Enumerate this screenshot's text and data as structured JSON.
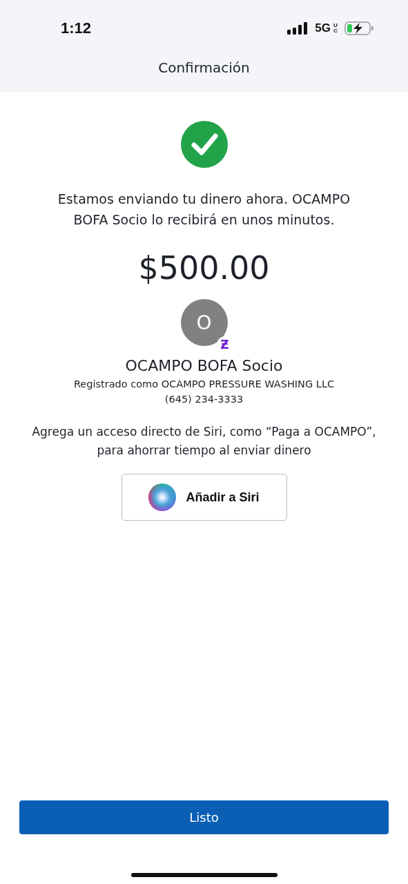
{
  "status_bar": {
    "time": "1:12",
    "network": "5G",
    "network_suffix": "UC"
  },
  "nav": {
    "title": "Confirmación"
  },
  "message": "Estamos enviando tu dinero ahora. OCAMPO BOFA Socio lo recibirá en unos minutos.",
  "amount": "$500.00",
  "recipient": {
    "initial": "O",
    "badge": "Ƶ",
    "name": "OCAMPO BOFA Socio",
    "registered": "Registrado como OCAMPO PRESSURE WASHING LLC",
    "phone": "(645) 234-3333"
  },
  "siri": {
    "hint": "Agrega un acceso directo de Siri, como “Paga a OCAMPO”, para ahorrar tiempo al enviar dinero",
    "button": "Añadir a Siri"
  },
  "done_button": "Listo"
}
